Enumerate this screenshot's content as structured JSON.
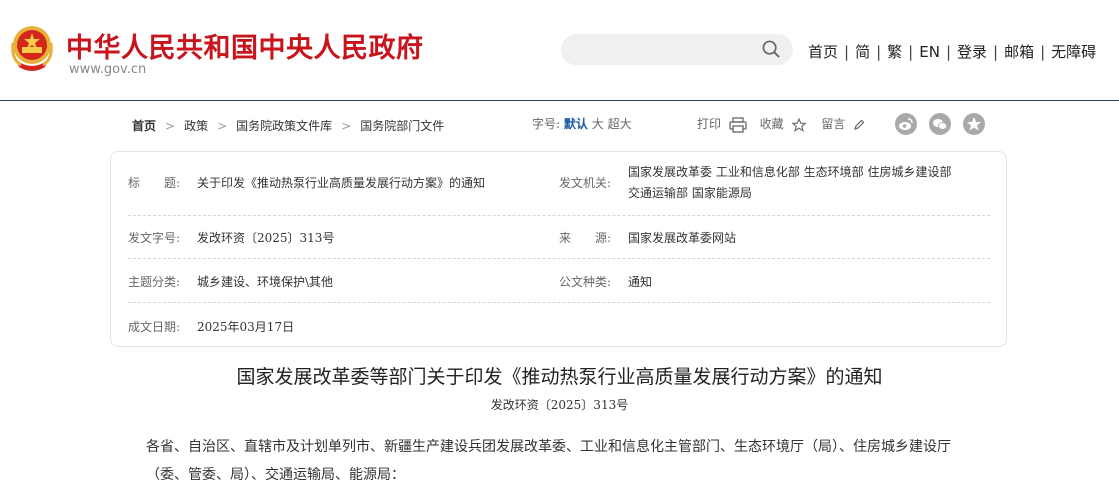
{
  "header": {
    "site_title": "中华人民共和国中央人民政府",
    "site_domain": "www.gov.cn",
    "search_placeholder": "",
    "nav": [
      "首页",
      "简",
      "繁",
      "EN",
      "登录",
      "邮箱",
      "无障碍"
    ],
    "nav_separator": "|"
  },
  "breadcrumb": {
    "items": [
      "首页",
      "政策",
      "国务院政策文件库",
      "国务院部门文件"
    ],
    "arrow": ">"
  },
  "tools": {
    "font_size_label": "字号:",
    "font_default": "默认",
    "font_large": "大",
    "font_xlarge": "超大",
    "print": "打印",
    "favorite": "收藏",
    "comment": "留言"
  },
  "share_icons": [
    "weibo-icon",
    "wechat-icon",
    "qzone-icon"
  ],
  "info": {
    "title_label": "标　　题:",
    "title_value": "关于印发《推动热泵行业高质量发展行动方案》的通知",
    "issuer_label": "发文机关:",
    "issuer_line1": "国家发展改革委  工业和信息化部  生态环境部  住房城乡建设部",
    "issuer_line2": "交通运输部  国家能源局",
    "docno_label": "发文字号:",
    "docno_value": "发改环资〔2025〕313号",
    "source_label": "来　　源:",
    "source_value": "国家发展改革委网站",
    "topic_label": "主题分类:",
    "topic_value": "城乡建设、环境保护\\其他",
    "type_label": "公文种类:",
    "type_value": "通知",
    "date_label": "成文日期:",
    "date_value": "2025年03月17日"
  },
  "article": {
    "title": "国家发展改革委等部门关于印发《推动热泵行业高质量发展行动方案》的通知",
    "doc_number": "发改环资〔2025〕313号",
    "body_line1": "各省、自治区、直辖市及计划单列市、新疆生产建设兵团发展改革委、工业和信息化主管部门、生态环境厅（局）、住房城乡建设厅",
    "body_line2": "（委、管委、局）、交通运输局、能源局："
  },
  "colors": {
    "brand_red": "#c8151d",
    "link_blue": "#1a5ba8",
    "header_rule": "#27435e"
  }
}
